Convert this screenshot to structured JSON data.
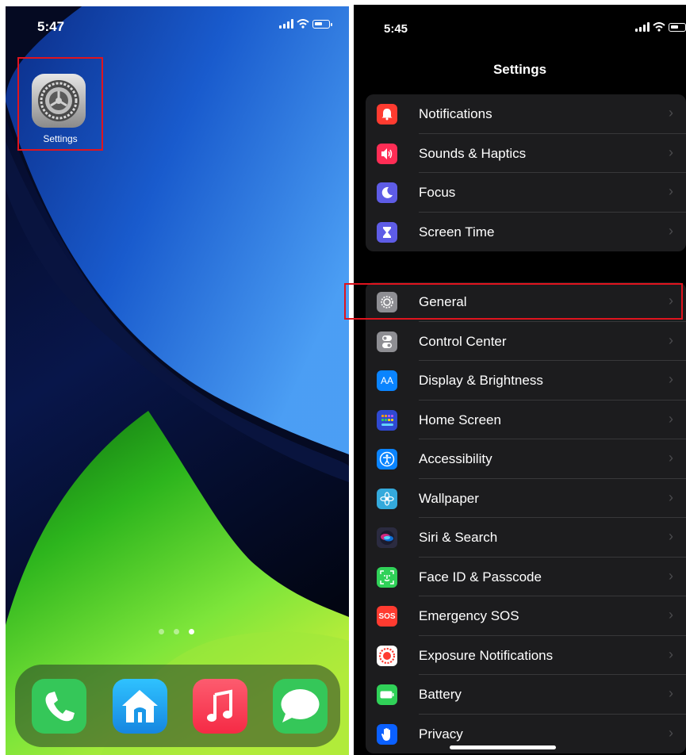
{
  "home_screen": {
    "status": {
      "time": "5:47"
    },
    "settings_app": {
      "label": "Settings"
    },
    "page_dots": 3,
    "active_page": 3,
    "dock": [
      {
        "icon": "phone-icon",
        "color": "#35c759"
      },
      {
        "icon": "home-icon",
        "color": "#1ea8f0"
      },
      {
        "icon": "music-icon",
        "color": "#f8394f"
      },
      {
        "icon": "messages-icon",
        "color": "#35c759"
      }
    ]
  },
  "settings_screen": {
    "status": {
      "time": "5:45"
    },
    "title": "Settings",
    "groups": [
      {
        "items": [
          {
            "label": "Notifications",
            "icon": "bell-icon",
            "color": "#ff3b30"
          },
          {
            "label": "Sounds & Haptics",
            "icon": "speaker-icon",
            "color": "#ff2d55"
          },
          {
            "label": "Focus",
            "icon": "moon-icon",
            "color": "#5e5ce6"
          },
          {
            "label": "Screen Time",
            "icon": "hourglass-icon",
            "color": "#5e5ce6"
          }
        ]
      },
      {
        "items": [
          {
            "label": "General",
            "icon": "gear-icon",
            "color": "#8e8e93",
            "highlighted": true
          },
          {
            "label": "Control Center",
            "icon": "toggles-icon",
            "color": "#8e8e93"
          },
          {
            "label": "Display & Brightness",
            "icon": "text-size-icon",
            "color": "#0a84ff",
            "glyph": "AA"
          },
          {
            "label": "Home Screen",
            "icon": "app-grid-icon",
            "color": "#2f49d1"
          },
          {
            "label": "Accessibility",
            "icon": "accessibility-icon",
            "color": "#0a84ff"
          },
          {
            "label": "Wallpaper",
            "icon": "flower-icon",
            "color": "#34aadc"
          },
          {
            "label": "Siri & Search",
            "icon": "siri-icon",
            "color": "#2b2b40"
          },
          {
            "label": "Face ID & Passcode",
            "icon": "face-id-icon",
            "color": "#30d158"
          },
          {
            "label": "Emergency SOS",
            "icon": "sos-icon",
            "color": "#ff3b30",
            "glyph": "SOS"
          },
          {
            "label": "Exposure Notifications",
            "icon": "exposure-icon",
            "color": "#ff3b30"
          },
          {
            "label": "Battery",
            "icon": "battery-icon",
            "color": "#30d158"
          },
          {
            "label": "Privacy",
            "icon": "hand-icon",
            "color": "#0a60ff"
          }
        ]
      }
    ]
  }
}
